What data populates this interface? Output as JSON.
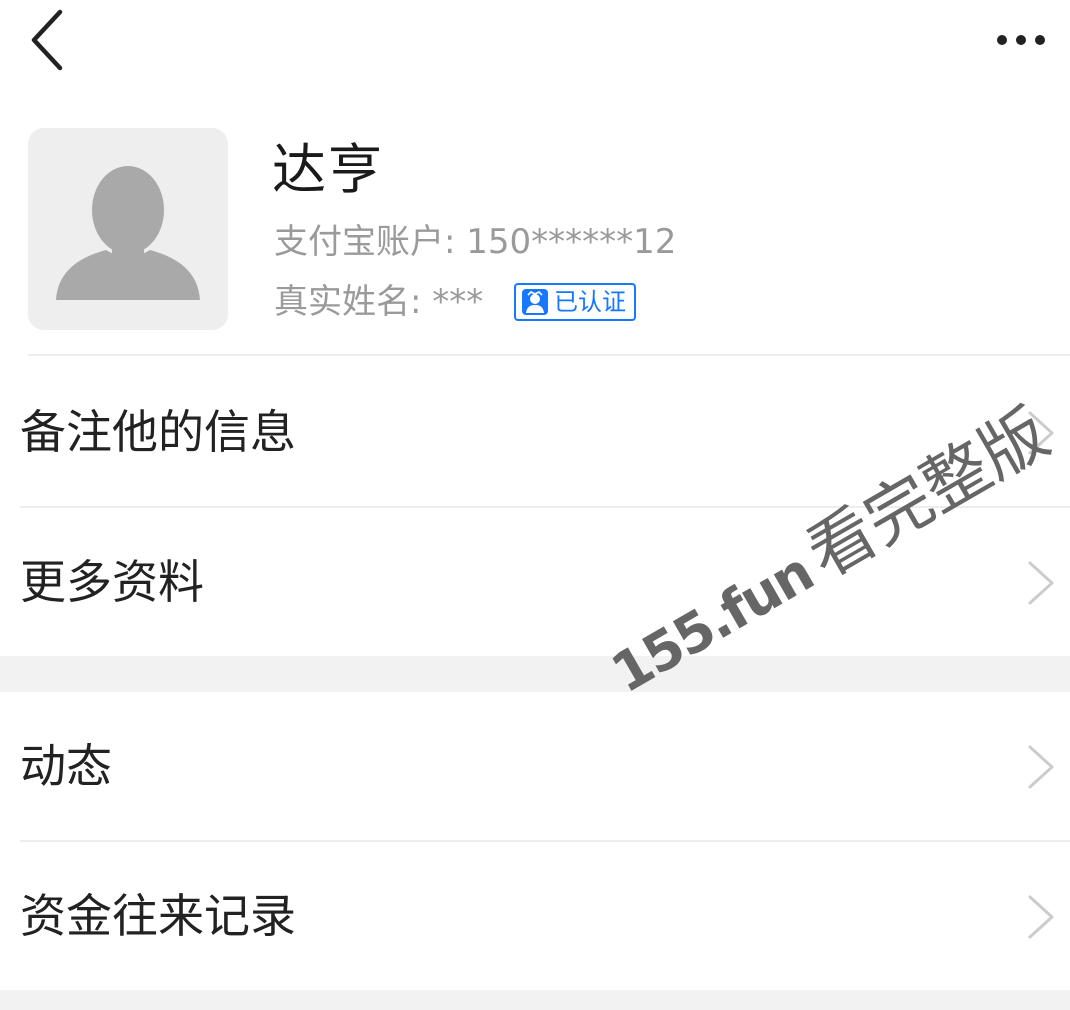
{
  "nav": {
    "back_icon": "chevron-left-icon",
    "more_icon": "more-dots-icon"
  },
  "profile": {
    "name": "达亨",
    "account_label": "支付宝账户:",
    "account_value": "150******12",
    "realname_label": "真实姓名:",
    "realname_value": "***",
    "verified_label": "已认证",
    "avatar_icon": "default-avatar-icon",
    "badge_icon": "verified-person-icon"
  },
  "menu": {
    "items": [
      {
        "label": "备注他的信息"
      },
      {
        "label": "更多资料"
      },
      {
        "label": "动态"
      },
      {
        "label": "资金往来记录"
      }
    ]
  },
  "watermark": {
    "domain": "155.fun",
    "text": "看完整版"
  },
  "colors": {
    "accent": "#1677ff",
    "secondary_text": "#9a9a9a",
    "section_gap": "#f2f2f2"
  }
}
